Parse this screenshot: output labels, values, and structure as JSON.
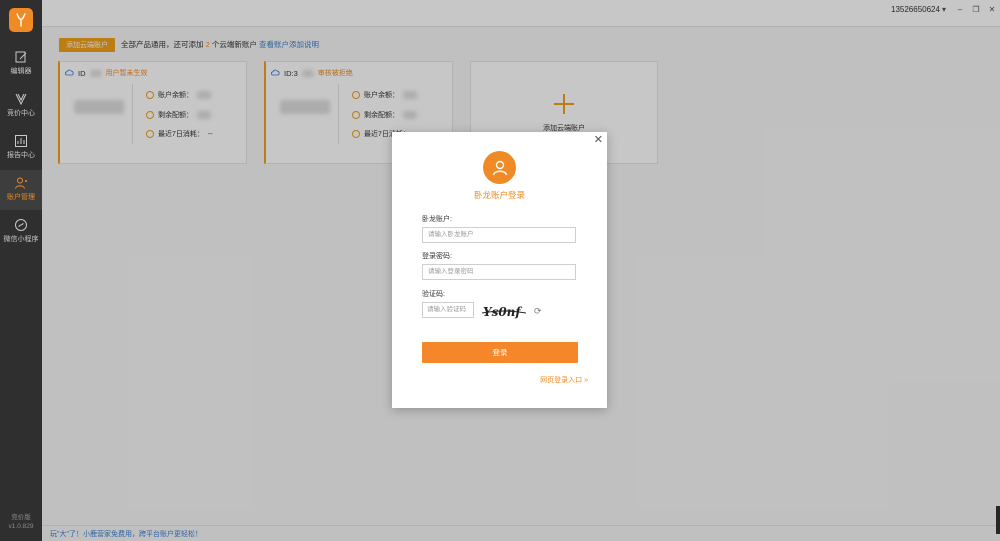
{
  "sidebar": {
    "items": [
      {
        "label": "编辑器",
        "icon": "edit-icon"
      },
      {
        "label": "竞价中心",
        "icon": "bid-icon"
      },
      {
        "label": "报告中心",
        "icon": "chart-icon"
      },
      {
        "label": "账户管理",
        "icon": "user-icon",
        "active": true
      },
      {
        "label": "微信小程序",
        "icon": "mini-program-icon"
      }
    ],
    "version_name": "竞价版",
    "version_num": "v1.0.829"
  },
  "topbar": {
    "phone": "13526650624"
  },
  "main": {
    "add_button": "添加云端账户",
    "tip_prefix": "全部产品通用，还可添加",
    "tip_count": "2",
    "tip_suffix": "个云端新账户",
    "tip_link": "查看账户添加说明",
    "cards": [
      {
        "id_label": "ID",
        "status": "用户暂未生效",
        "balance": "账户余额：",
        "budget": "剩余配额：",
        "cost7": "最近7日消耗：",
        "cost7_val": "--"
      },
      {
        "id_label": "ID:3",
        "status": "审核被拒绝",
        "balance": "账户余额：",
        "budget": "剩余配额：",
        "cost7": "最近7日消耗：",
        "cost7_val": "--"
      }
    ],
    "add_card_label": "添加云端账户"
  },
  "footer": {
    "text": "玩\"大\"了！小鹿营家免费用，跨平台账户更轻松！"
  },
  "modal": {
    "title": "卧龙账户登录",
    "account_label": "卧龙账户:",
    "account_placeholder": "请输入卧龙账户",
    "password_label": "登录密码:",
    "password_placeholder": "请输入登录密码",
    "captcha_label": "验证码:",
    "captcha_placeholder": "请输入验证码",
    "captcha_text": "Ys0nf",
    "login_button": "登录",
    "web_login_link": "网页登录入口 »"
  },
  "colors": {
    "accent": "#f08a24",
    "sidebar_bg": "#2f2f2f",
    "link": "#3a7fd0"
  }
}
